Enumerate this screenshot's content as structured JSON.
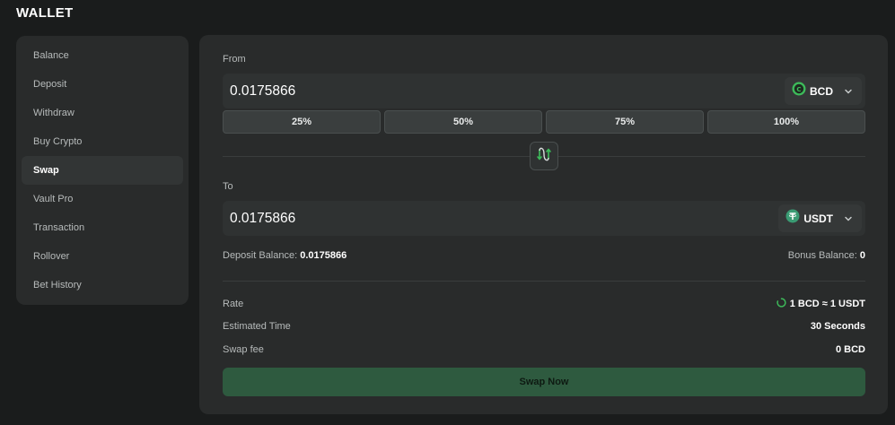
{
  "header": {
    "title": "WALLET"
  },
  "sidebar": {
    "items": [
      {
        "label": "Balance"
      },
      {
        "label": "Deposit"
      },
      {
        "label": "Withdraw"
      },
      {
        "label": "Buy Crypto"
      },
      {
        "label": "Swap",
        "active": true
      },
      {
        "label": "Vault Pro"
      },
      {
        "label": "Transaction"
      },
      {
        "label": "Rollover"
      },
      {
        "label": "Bet History"
      }
    ]
  },
  "swap": {
    "from": {
      "label": "From",
      "amount": "0.0175866",
      "coin": "BCD",
      "coin_color": "#3dbb5a"
    },
    "percent_buttons": [
      "25%",
      "50%",
      "75%",
      "100%"
    ],
    "to": {
      "label": "To",
      "amount": "0.0175866",
      "coin": "USDT",
      "coin_color": "#3a9b73"
    },
    "deposit_balance_label": "Deposit Balance:",
    "deposit_balance_value": "0.0175866",
    "bonus_balance_label": "Bonus Balance:",
    "bonus_balance_value": "0",
    "rate_label": "Rate",
    "rate_value": "1 BCD ≈ 1 USDT",
    "estimated_time_label": "Estimated Time",
    "estimated_time_value": "30 Seconds",
    "fee_label": "Swap fee",
    "fee_value": "0 BCD",
    "submit_label": "Swap Now"
  },
  "colors": {
    "accent": "#3dbb5a",
    "button": "#2e5a3f",
    "panel": "#292b2b",
    "background": "#1a1c1c"
  }
}
